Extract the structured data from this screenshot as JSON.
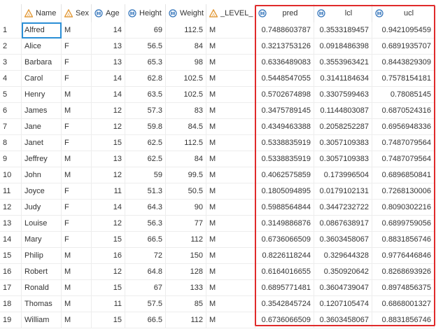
{
  "colors": {
    "accent_selection": "#2b8fd6",
    "highlight_box": "#e02b2b",
    "char_icon": "#e39b3a",
    "num_icon": "#2b6fb8"
  },
  "columns": [
    {
      "key": "rownum",
      "label": "",
      "icon": ""
    },
    {
      "key": "Name",
      "label": "Name",
      "icon": "character-type-icon"
    },
    {
      "key": "Sex",
      "label": "Sex",
      "icon": "character-type-icon"
    },
    {
      "key": "Age",
      "label": "Age",
      "icon": "numeric-type-icon"
    },
    {
      "key": "Height",
      "label": "Height",
      "icon": "numeric-type-icon"
    },
    {
      "key": "Weight",
      "label": "Weight",
      "icon": "numeric-type-icon"
    },
    {
      "key": "LEVEL",
      "label": "_LEVEL_",
      "icon": "character-type-icon"
    },
    {
      "key": "pred",
      "label": "pred",
      "icon": "numeric-type-icon"
    },
    {
      "key": "lcl",
      "label": "lcl",
      "icon": "numeric-type-icon"
    },
    {
      "key": "ucl",
      "label": "ucl",
      "icon": "numeric-type-icon"
    }
  ],
  "rows": [
    {
      "rownum": "1",
      "Name": "Alfred",
      "Sex": "M",
      "Age": "14",
      "Height": "69",
      "Weight": "112.5",
      "LEVEL": "M",
      "pred": "0.7488603787",
      "lcl": "0.3533189457",
      "ucl": "0.9421095459"
    },
    {
      "rownum": "2",
      "Name": "Alice",
      "Sex": "F",
      "Age": "13",
      "Height": "56.5",
      "Weight": "84",
      "LEVEL": "M",
      "pred": "0.3213753126",
      "lcl": "0.0918486398",
      "ucl": "0.6891935707"
    },
    {
      "rownum": "3",
      "Name": "Barbara",
      "Sex": "F",
      "Age": "13",
      "Height": "65.3",
      "Weight": "98",
      "LEVEL": "M",
      "pred": "0.6336489083",
      "lcl": "0.3553963421",
      "ucl": "0.8443829309"
    },
    {
      "rownum": "4",
      "Name": "Carol",
      "Sex": "F",
      "Age": "14",
      "Height": "62.8",
      "Weight": "102.5",
      "LEVEL": "M",
      "pred": "0.5448547055",
      "lcl": "0.3141184634",
      "ucl": "0.7578154181"
    },
    {
      "rownum": "5",
      "Name": "Henry",
      "Sex": "M",
      "Age": "14",
      "Height": "63.5",
      "Weight": "102.5",
      "LEVEL": "M",
      "pred": "0.5702674898",
      "lcl": "0.3307599463",
      "ucl": "0.78085145"
    },
    {
      "rownum": "6",
      "Name": "James",
      "Sex": "M",
      "Age": "12",
      "Height": "57.3",
      "Weight": "83",
      "LEVEL": "M",
      "pred": "0.3475789145",
      "lcl": "0.1144803087",
      "ucl": "0.6870524316"
    },
    {
      "rownum": "7",
      "Name": "Jane",
      "Sex": "F",
      "Age": "12",
      "Height": "59.8",
      "Weight": "84.5",
      "LEVEL": "M",
      "pred": "0.4349463388",
      "lcl": "0.2058252287",
      "ucl": "0.6956948336"
    },
    {
      "rownum": "8",
      "Name": "Janet",
      "Sex": "F",
      "Age": "15",
      "Height": "62.5",
      "Weight": "112.5",
      "LEVEL": "M",
      "pred": "0.5338835919",
      "lcl": "0.3057109383",
      "ucl": "0.7487079564"
    },
    {
      "rownum": "9",
      "Name": "Jeffrey",
      "Sex": "M",
      "Age": "13",
      "Height": "62.5",
      "Weight": "84",
      "LEVEL": "M",
      "pred": "0.5338835919",
      "lcl": "0.3057109383",
      "ucl": "0.7487079564"
    },
    {
      "rownum": "10",
      "Name": "John",
      "Sex": "M",
      "Age": "12",
      "Height": "59",
      "Weight": "99.5",
      "LEVEL": "M",
      "pred": "0.4062575859",
      "lcl": "0.173996504",
      "ucl": "0.6896850841"
    },
    {
      "rownum": "11",
      "Name": "Joyce",
      "Sex": "F",
      "Age": "11",
      "Height": "51.3",
      "Weight": "50.5",
      "LEVEL": "M",
      "pred": "0.1805094895",
      "lcl": "0.0179102131",
      "ucl": "0.7268130006"
    },
    {
      "rownum": "12",
      "Name": "Judy",
      "Sex": "F",
      "Age": "14",
      "Height": "64.3",
      "Weight": "90",
      "LEVEL": "M",
      "pred": "0.5988564844",
      "lcl": "0.3447232722",
      "ucl": "0.8090302216"
    },
    {
      "rownum": "13",
      "Name": "Louise",
      "Sex": "F",
      "Age": "12",
      "Height": "56.3",
      "Weight": "77",
      "LEVEL": "M",
      "pred": "0.3149886876",
      "lcl": "0.0867638917",
      "ucl": "0.6899759056"
    },
    {
      "rownum": "14",
      "Name": "Mary",
      "Sex": "F",
      "Age": "15",
      "Height": "66.5",
      "Weight": "112",
      "LEVEL": "M",
      "pred": "0.6736066509",
      "lcl": "0.3603458067",
      "ucl": "0.8831856746"
    },
    {
      "rownum": "15",
      "Name": "Philip",
      "Sex": "M",
      "Age": "16",
      "Height": "72",
      "Weight": "150",
      "LEVEL": "M",
      "pred": "0.8226118244",
      "lcl": "0.329644328",
      "ucl": "0.9776446846"
    },
    {
      "rownum": "16",
      "Name": "Robert",
      "Sex": "M",
      "Age": "12",
      "Height": "64.8",
      "Weight": "128",
      "LEVEL": "M",
      "pred": "0.6164016655",
      "lcl": "0.350920642",
      "ucl": "0.8268693926"
    },
    {
      "rownum": "17",
      "Name": "Ronald",
      "Sex": "M",
      "Age": "15",
      "Height": "67",
      "Weight": "133",
      "LEVEL": "M",
      "pred": "0.6895771481",
      "lcl": "0.3604739047",
      "ucl": "0.8974856375"
    },
    {
      "rownum": "18",
      "Name": "Thomas",
      "Sex": "M",
      "Age": "11",
      "Height": "57.5",
      "Weight": "85",
      "LEVEL": "M",
      "pred": "0.3542845724",
      "lcl": "0.1207105474",
      "ucl": "0.6868001327"
    },
    {
      "rownum": "19",
      "Name": "William",
      "Sex": "M",
      "Age": "15",
      "Height": "66.5",
      "Weight": "112",
      "LEVEL": "M",
      "pred": "0.6736066509",
      "lcl": "0.3603458067",
      "ucl": "0.8831856746"
    }
  ],
  "selected_cell": {
    "row": 0,
    "column": "Name"
  }
}
